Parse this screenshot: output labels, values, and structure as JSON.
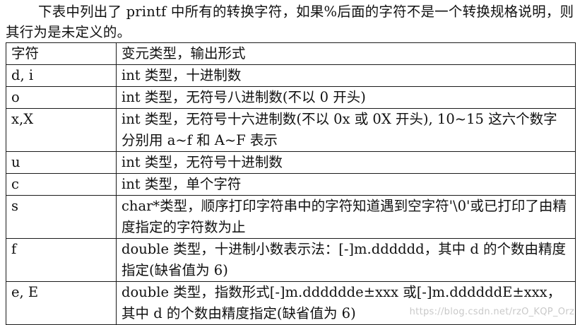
{
  "intro_text": "下表中列出了 printf 中所有的转换字符，如果%后面的字符不是一个转换规格说明，则其行为是未定义的。",
  "table": {
    "header": {
      "col1": "字符",
      "col2": "变元类型，输出形式"
    },
    "rows": [
      {
        "char": "d, i",
        "desc": "int 类型，十进制数"
      },
      {
        "char": "o",
        "desc": "int 类型，无符号八进制数(不以 0 开头)"
      },
      {
        "char": "x,X",
        "desc": "int 类型，无符号十六进制数(不以 0x 或 0X 开头), 10~15 这六个数字分别用 a~f 和 A~F 表示"
      },
      {
        "char": "u",
        "desc": "int 类型，无符号十进制数"
      },
      {
        "char": "c",
        "desc": "int 类型，单个字符"
      },
      {
        "char": "s",
        "desc": "char*类型，顺序打印字符串中的字符知道遇到空字符'\\0'或已打印了由精度指定的字符数为止"
      },
      {
        "char": "f",
        "desc": "double 类型，十进制小数表示法：[-]m.dddddd，其中 d 的个数由精度指定(缺省值为 6)"
      },
      {
        "char": "e, E",
        "desc": "double 类型，指数形式[-]m.dddddde±xxx 或[-]m.ddddddE±xxx，其中 d 的个数由精度指定(缺省值为 6)"
      }
    ]
  },
  "watermark": "https://blog.csdn.net/rzO_KQP_Orz"
}
